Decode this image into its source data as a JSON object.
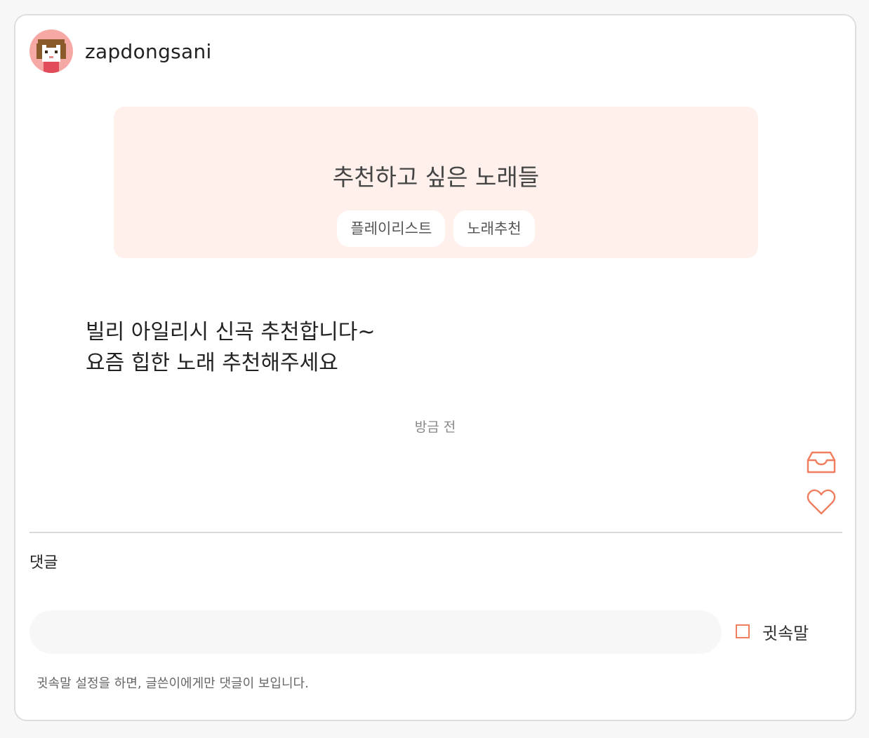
{
  "post": {
    "username": "zapdongsani",
    "banner_title": "추천하고 싶은 노래들",
    "tags": [
      "플레이리스트",
      "노래추천"
    ],
    "body_lines": [
      "빌리 아일리시 신곡 추천합니다~",
      "요즘 힙한 노래 추천해주세요"
    ],
    "timestamp": "방금 전"
  },
  "actions": {
    "save_icon": "inbox-tray-icon",
    "like_icon": "heart-icon",
    "accent_color": "#ef7d5e"
  },
  "comments": {
    "label": "댓글",
    "input_value": "",
    "secret_label": "귓속말",
    "secret_checked": false,
    "hint": "귓속말 설정을 하면, 글쓴이에게만 댓글이 보입니다."
  },
  "colors": {
    "banner_bg": "#fff0ec",
    "avatar_bg": "#f6a9a4"
  }
}
